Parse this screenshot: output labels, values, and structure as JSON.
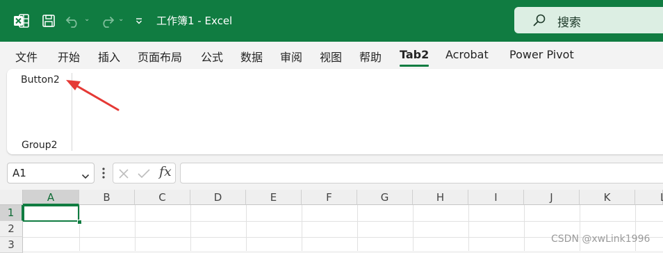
{
  "titlebar": {
    "doc_title": "工作簿1  -  Excel",
    "search_placeholder": "搜索"
  },
  "tabs": [
    {
      "label": "文件"
    },
    {
      "label": "开始"
    },
    {
      "label": "插入"
    },
    {
      "label": "页面布局"
    },
    {
      "label": "公式"
    },
    {
      "label": "数据"
    },
    {
      "label": "审阅"
    },
    {
      "label": "视图"
    },
    {
      "label": "帮助"
    },
    {
      "label": "Tab2",
      "active": true
    },
    {
      "label": "Acrobat"
    },
    {
      "label": "Power Pivot"
    }
  ],
  "ribbon": {
    "button_label": "Button2",
    "group_label": "Group2"
  },
  "formula_bar": {
    "name_box_value": "A1",
    "fx_label": "fx",
    "formula_value": ""
  },
  "grid": {
    "columns": [
      "A",
      "B",
      "C",
      "D",
      "E",
      "F",
      "G",
      "H",
      "I",
      "J",
      "K",
      "L"
    ],
    "rows": [
      "1",
      "2",
      "3"
    ],
    "active_cell": "A1"
  },
  "watermark": "CSDN @xwLink1996",
  "colors": {
    "excel_green": "#107c41",
    "annotation_arrow": "#e53935"
  }
}
